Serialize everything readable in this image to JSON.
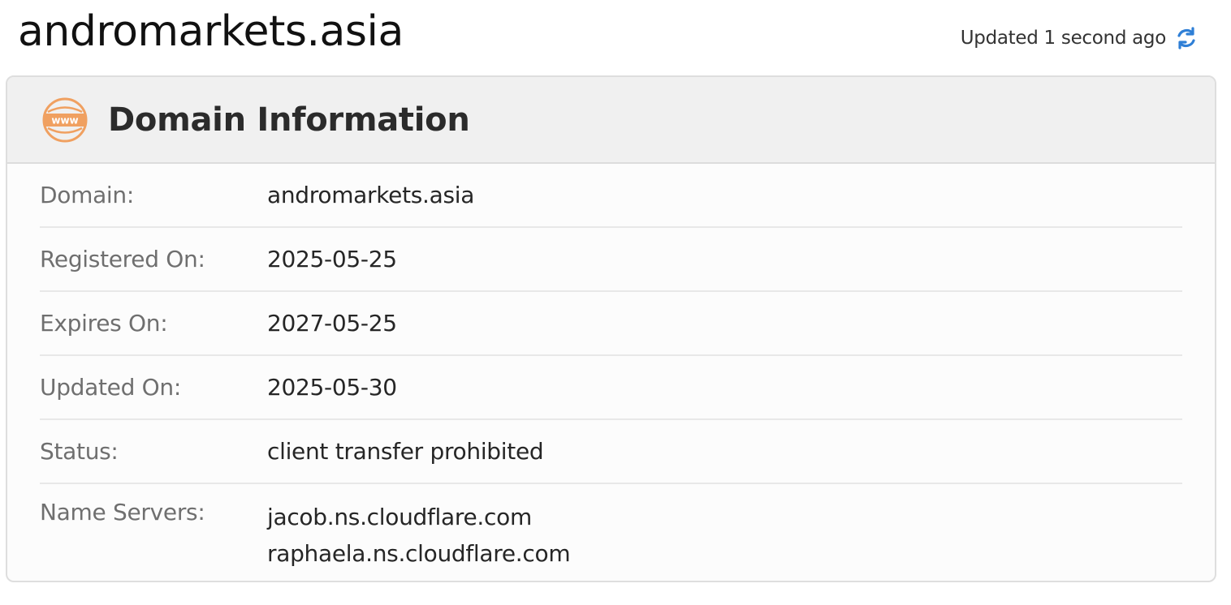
{
  "header": {
    "domain": "andromarkets.asia",
    "updated_text": "Updated 1 second ago",
    "refresh_icon": "refresh-icon",
    "accent_color": "#2f7fd6"
  },
  "card": {
    "icon": "www-icon",
    "icon_text": "www",
    "icon_color": "#f0a060",
    "title": "Domain Information",
    "rows": [
      {
        "label": "Domain:",
        "value": "andromarkets.asia"
      },
      {
        "label": "Registered On:",
        "value": "2025-05-25"
      },
      {
        "label": "Expires On:",
        "value": "2027-05-25"
      },
      {
        "label": "Updated On:",
        "value": "2025-05-30"
      },
      {
        "label": "Status:",
        "value": "client transfer prohibited"
      },
      {
        "label": "Name Servers:",
        "values": [
          "jacob.ns.cloudflare.com",
          "raphaela.ns.cloudflare.com"
        ]
      }
    ]
  }
}
